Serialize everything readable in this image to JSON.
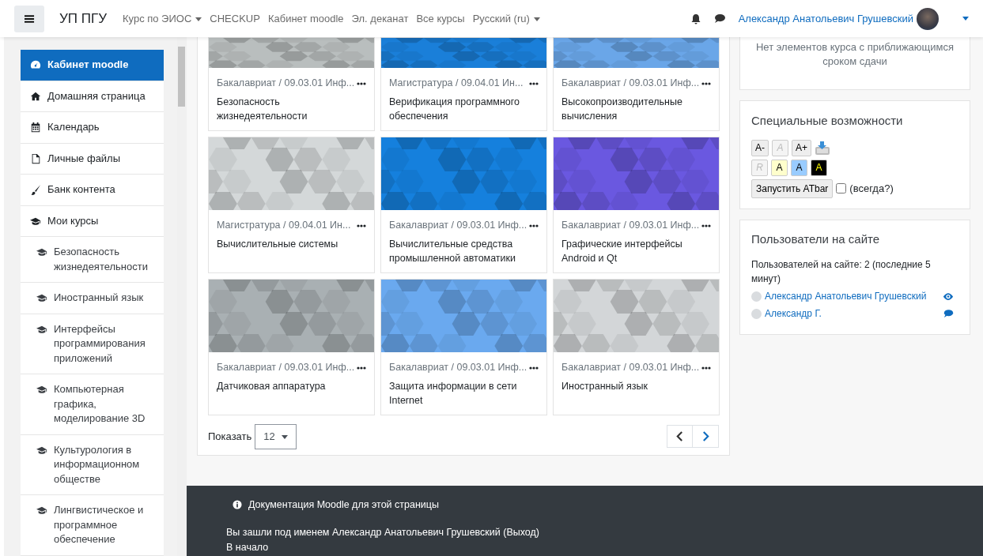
{
  "navbar": {
    "brand": "УП ПГУ",
    "menu": [
      {
        "label": "Курс по ЭИОС",
        "dropdown": true
      },
      {
        "label": "CHECKUP",
        "dropdown": false
      },
      {
        "label": "Кабинет moodle",
        "dropdown": false
      },
      {
        "label": "Эл. деканат",
        "dropdown": false
      },
      {
        "label": "Все курсы",
        "dropdown": false
      },
      {
        "label": "Русский (ru)",
        "dropdown": true
      }
    ],
    "user": "Александр Анатольевич Грушевский"
  },
  "sidebar": {
    "items": [
      {
        "kind": "dashboard",
        "label": "Кабинет moodle",
        "selected": true
      },
      {
        "kind": "home",
        "label": "Домашняя страница",
        "selected": false
      },
      {
        "kind": "calendar",
        "label": "Календарь",
        "selected": false
      },
      {
        "kind": "file",
        "label": "Личные файлы",
        "selected": false
      },
      {
        "kind": "brush",
        "label": "Банк контента",
        "selected": false
      },
      {
        "kind": "courses",
        "label": "Мои курсы",
        "selected": false,
        "children": [
          {
            "kind": "course",
            "label": "Безопасность жизнедеятельности",
            "selected": false
          },
          {
            "kind": "course",
            "label": "Иностранный язык",
            "selected": false
          },
          {
            "kind": "course",
            "label": "Интерфейсы программирования приложений",
            "selected": false
          },
          {
            "kind": "course",
            "label": "Компьютерная графика, моделирование 3D",
            "selected": false
          },
          {
            "kind": "course",
            "label": "Культурология в информационном обществе",
            "selected": false
          },
          {
            "kind": "course",
            "label": "Лингвистическое и программное обеспечение",
            "selected": false
          }
        ]
      }
    ]
  },
  "courses": [
    {
      "category": "Бакалавриат / 09.03.01 Инф...",
      "name": "Безопасность жизнедеятельности",
      "color": "#b9bebe"
    },
    {
      "category": "Магистратура / 09.04.01 Ин...",
      "name": "Верификация программного обеспечения",
      "color": "#1a7fd9"
    },
    {
      "category": "Бакалавриат / 09.03.01 Инф...",
      "name": "Высокопроизводительные вычисления",
      "color": "#6aa6e8"
    },
    {
      "category": "Магистратура / 09.04.01 Ин...",
      "name": "Вычислительные системы",
      "color": "#d4d8d9"
    },
    {
      "category": "Бакалавриат / 09.03.01 Инф...",
      "name": "Вычислительные средства промышленной автоматики",
      "color": "#1580dd"
    },
    {
      "category": "Бакалавриат / 09.03.01 Инф...",
      "name": "Графические интерфейсы Android и Qt",
      "color": "#6a58e0"
    },
    {
      "category": "Бакалавриат / 09.03.01 Инф...",
      "name": "Датчиковая аппаратура",
      "color": "#a9b0b3"
    },
    {
      "category": "Бакалавриат / 09.03.01 Инф...",
      "name": "Защита информации в сети Internet",
      "color": "#6aa9ef"
    },
    {
      "category": "Бакалавриат / 09.03.01 Инф...",
      "name": "Иностранный язык",
      "color": "#d3d6d8"
    }
  ],
  "paging": {
    "label": "Показать",
    "value": "12"
  },
  "timeline": {
    "empty_text": "Нет элементов курса с приближающимся сроком сдачи"
  },
  "accessibility": {
    "title": "Специальные возможности",
    "rows": [
      [
        {
          "kind": "text",
          "label": "A-",
          "disabled": false
        },
        {
          "kind": "text",
          "label": "A",
          "disabled": true
        },
        {
          "kind": "text",
          "label": "A+",
          "disabled": false
        },
        {
          "kind": "save"
        }
      ],
      [
        {
          "kind": "text",
          "label": "R",
          "disabled": true
        },
        {
          "kind": "contrast",
          "label": "A",
          "color": "#ffffcc"
        },
        {
          "kind": "contrast",
          "label": "A",
          "color": "#99ccff"
        },
        {
          "kind": "contrast",
          "label": "A",
          "color": "#000000"
        }
      ]
    ],
    "launch": "Запустить ATbar",
    "always": {
      "label": "(всегда?)",
      "checked": false
    }
  },
  "online": {
    "title": "Пользователи на сайте",
    "summary": "Пользователей на сайте: 2 (последние 5 минут)",
    "users": [
      {
        "name": "Александр Анатольевич Грушевский",
        "kind": "eye"
      },
      {
        "name": "Александр Г.",
        "kind": "message"
      }
    ]
  },
  "footer": {
    "doc_link": "Документация Moodle для этой страницы",
    "login_prefix": "Вы зашли под именем",
    "login_user": "Александр Анатольевич Грушевский",
    "logout": "(Выход)",
    "home": "В начало"
  }
}
